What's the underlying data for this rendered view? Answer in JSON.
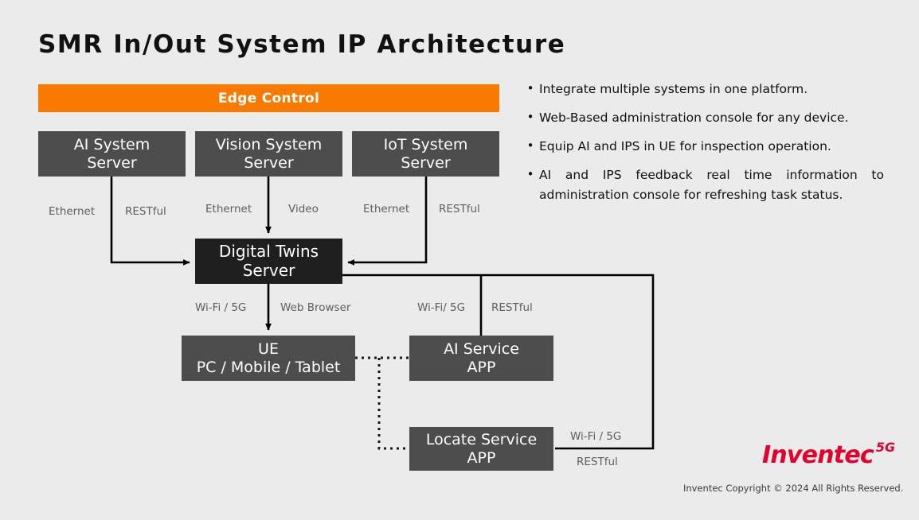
{
  "slide": {
    "title": "SMR In/Out System IP Architecture",
    "background_color": "#ebebeb"
  },
  "edge_control": {
    "label": "Edge Control",
    "color": "#fa7a00"
  },
  "nodes": {
    "ai_system": {
      "line1": "AI System",
      "line2": "Server",
      "color": "#4d4d4d"
    },
    "vision_system": {
      "line1": "Vision System",
      "line2": "Server",
      "color": "#4d4d4d"
    },
    "iot_system": {
      "line1": "IoT System",
      "line2": "Server",
      "color": "#4d4d4d"
    },
    "digital_twins": {
      "line1": "Digital Twins",
      "line2": "Server",
      "color": "#1f1f1f"
    },
    "ue": {
      "line1": "UE",
      "line2": "PC / Mobile / Tablet",
      "color": "#4d4d4d"
    },
    "ai_service": {
      "line1": "AI Service",
      "line2": "APP",
      "color": "#4d4d4d"
    },
    "locate_service": {
      "line1": "Locate Service",
      "line2": "APP",
      "color": "#4d4d4d"
    }
  },
  "link_labels": {
    "ai_ethernet": "Ethernet",
    "ai_restful": "RESTful",
    "vision_ethernet": "Ethernet",
    "vision_video": "Video",
    "iot_ethernet": "Ethernet",
    "iot_restful": "RESTful",
    "ue_wifi": "Wi-Fi / 5G",
    "ue_web_browser": "Web Browser",
    "ai_service_wifi": "Wi-Fi/ 5G",
    "ai_service_restful": "RESTful",
    "locate_wifi": "Wi-Fi / 5G",
    "locate_restful": "RESTful"
  },
  "bullets": [
    "Integrate multiple systems in one platform.",
    "Web-Based administration console for any device.",
    "Equip AI and IPS in UE for inspection operation.",
    "AI and IPS feedback real time information to administration console for refreshing task status."
  ],
  "bullet_marker": "•",
  "footer": {
    "logo_word": "Inventec",
    "logo_badge": "5G",
    "logo_color": "#e4002b",
    "copyright": "Inventec Copyright © 2024  All Rights Reserved."
  }
}
